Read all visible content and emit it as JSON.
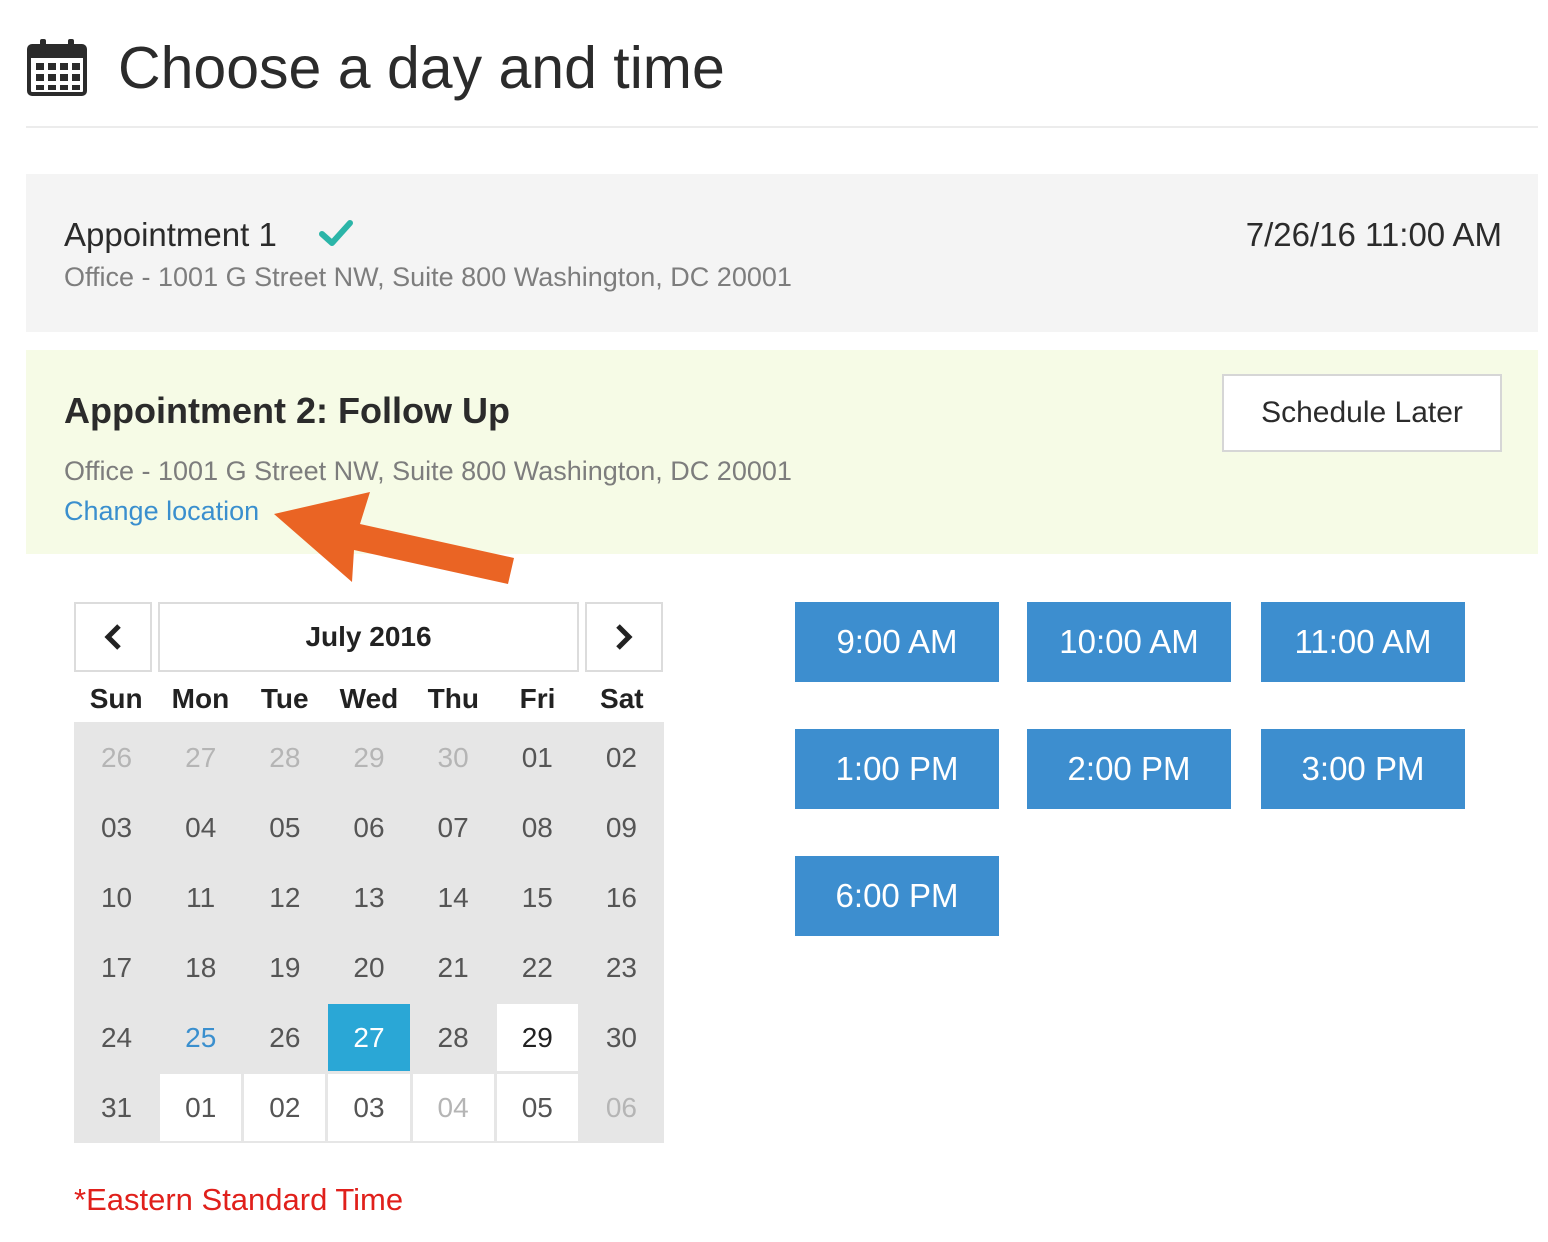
{
  "header": {
    "title": "Choose a day and time",
    "icon": "calendar-icon"
  },
  "appointment1": {
    "title": "Appointment 1",
    "status_icon": "checkmark-icon",
    "address": "Office - 1001 G Street NW, Suite 800 Washington, DC 20001",
    "datetime": "7/26/16 11:00 AM"
  },
  "appointment2": {
    "title": "Appointment 2: Follow Up",
    "address": "Office - 1001 G Street NW, Suite 800 Washington, DC 20001",
    "change_location": "Change location",
    "schedule_later": "Schedule Later"
  },
  "calendar": {
    "prev": "‹",
    "next": "›",
    "month": "July 2016",
    "weekdays": [
      "Sun",
      "Mon",
      "Tue",
      "Wed",
      "Thu",
      "Fri",
      "Sat"
    ],
    "days": [
      {
        "label": "26",
        "state": "dim"
      },
      {
        "label": "27",
        "state": "dim"
      },
      {
        "label": "28",
        "state": "dim"
      },
      {
        "label": "29",
        "state": "dim"
      },
      {
        "label": "30",
        "state": "dim"
      },
      {
        "label": "01",
        "state": "normal"
      },
      {
        "label": "02",
        "state": "normal"
      },
      {
        "label": "03",
        "state": "normal"
      },
      {
        "label": "04",
        "state": "normal"
      },
      {
        "label": "05",
        "state": "normal"
      },
      {
        "label": "06",
        "state": "normal"
      },
      {
        "label": "07",
        "state": "normal"
      },
      {
        "label": "08",
        "state": "normal"
      },
      {
        "label": "09",
        "state": "normal"
      },
      {
        "label": "10",
        "state": "normal"
      },
      {
        "label": "11",
        "state": "normal"
      },
      {
        "label": "12",
        "state": "normal"
      },
      {
        "label": "13",
        "state": "normal"
      },
      {
        "label": "14",
        "state": "normal"
      },
      {
        "label": "15",
        "state": "normal"
      },
      {
        "label": "16",
        "state": "normal"
      },
      {
        "label": "17",
        "state": "normal"
      },
      {
        "label": "18",
        "state": "normal"
      },
      {
        "label": "19",
        "state": "normal"
      },
      {
        "label": "20",
        "state": "normal"
      },
      {
        "label": "21",
        "state": "normal"
      },
      {
        "label": "22",
        "state": "normal"
      },
      {
        "label": "23",
        "state": "normal"
      },
      {
        "label": "24",
        "state": "normal"
      },
      {
        "label": "25",
        "state": "today"
      },
      {
        "label": "26",
        "state": "normal"
      },
      {
        "label": "27",
        "state": "selected"
      },
      {
        "label": "28",
        "state": "normal"
      },
      {
        "label": "29",
        "state": "available"
      },
      {
        "label": "30",
        "state": "normal"
      },
      {
        "label": "31",
        "state": "normal"
      },
      {
        "label": "01",
        "state": "next-month"
      },
      {
        "label": "02",
        "state": "next-month"
      },
      {
        "label": "03",
        "state": "next-month"
      },
      {
        "label": "04",
        "state": "dim-white"
      },
      {
        "label": "05",
        "state": "next-month"
      },
      {
        "label": "06",
        "state": "dim"
      }
    ],
    "timezone_note": "*Eastern Standard Time"
  },
  "time_slots": [
    "9:00 AM",
    "10:00 AM",
    "11:00 AM",
    "1:00 PM",
    "2:00 PM",
    "3:00 PM",
    "6:00 PM"
  ],
  "colors": {
    "slot_bg": "#3d8ecf",
    "selected_day": "#2aa7d6",
    "link": "#3a8fce",
    "check": "#2bb5a8",
    "arrow": "#ea6424",
    "timezone": "#e0201b",
    "appt2_bg": "#f6fbe6"
  }
}
